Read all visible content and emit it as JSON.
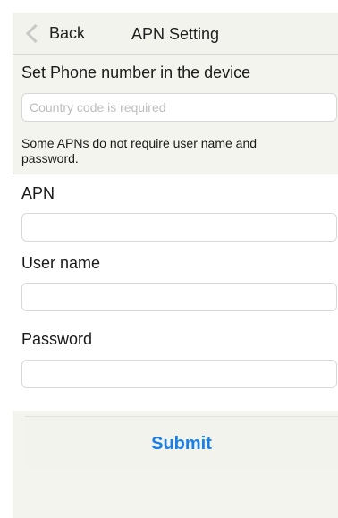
{
  "nav": {
    "back_label": "Back",
    "title": "APN Setting"
  },
  "phone": {
    "label": "Set Phone number in the device",
    "placeholder": "Country code is required",
    "value": ""
  },
  "note": "Some APNs do not require user name and password.",
  "apn": {
    "label": "APN",
    "value": ""
  },
  "username": {
    "label": "User name",
    "value": ""
  },
  "password": {
    "label": "Password",
    "value": ""
  },
  "submit_label": "Submit",
  "colors": {
    "accent": "#1a7fe6",
    "nav_background": "#f3f3ed",
    "content_background": "#f4f4ef"
  },
  "icons": {
    "back": "chevron-left-icon"
  }
}
